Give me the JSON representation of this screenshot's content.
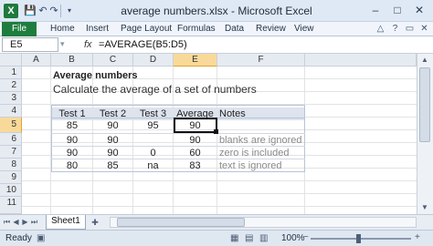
{
  "window": {
    "title": "average numbers.xlsx - Microsoft Excel",
    "app_icon": "X",
    "quick_access": [
      "save-icon",
      "undo-icon",
      "redo-icon",
      "customize-icon"
    ],
    "controls": {
      "minimize": "–",
      "maximize": "□",
      "close": "✕"
    }
  },
  "ribbon": {
    "file_tab": "File",
    "tabs": [
      "Home",
      "Insert",
      "Page Layout",
      "Formulas",
      "Data",
      "Review",
      "View"
    ]
  },
  "formula_bar": {
    "name_box": "E5",
    "fx": "fx",
    "formula": "=AVERAGE(B5:D5)"
  },
  "sheet": {
    "columns": [
      "A",
      "B",
      "C",
      "D",
      "E",
      "F"
    ],
    "rows": [
      "1",
      "2",
      "3",
      "4",
      "5",
      "6",
      "7",
      "8",
      "9",
      "10",
      "11"
    ],
    "selected_cell": "E5",
    "title": "Average numbers",
    "subtitle": "Calculate the average of a set of numbers",
    "table": {
      "headers": [
        "Test 1",
        "Test 2",
        "Test 3",
        "Average",
        "Notes"
      ],
      "rows": [
        {
          "t1": "85",
          "t2": "90",
          "t3": "95",
          "avg": "90",
          "note": ""
        },
        {
          "t1": "90",
          "t2": "90",
          "t3": "",
          "avg": "90",
          "note": "blanks are ignored"
        },
        {
          "t1": "90",
          "t2": "90",
          "t3": "0",
          "avg": "60",
          "note": "zero is included"
        },
        {
          "t1": "80",
          "t2": "85",
          "t3": "na",
          "avg": "83",
          "note": "text is ignored"
        }
      ]
    }
  },
  "sheet_tabs": {
    "active": "Sheet1"
  },
  "status": {
    "ready": "Ready",
    "zoom": "100%",
    "zoom_minus": "−",
    "zoom_plus": "+"
  }
}
